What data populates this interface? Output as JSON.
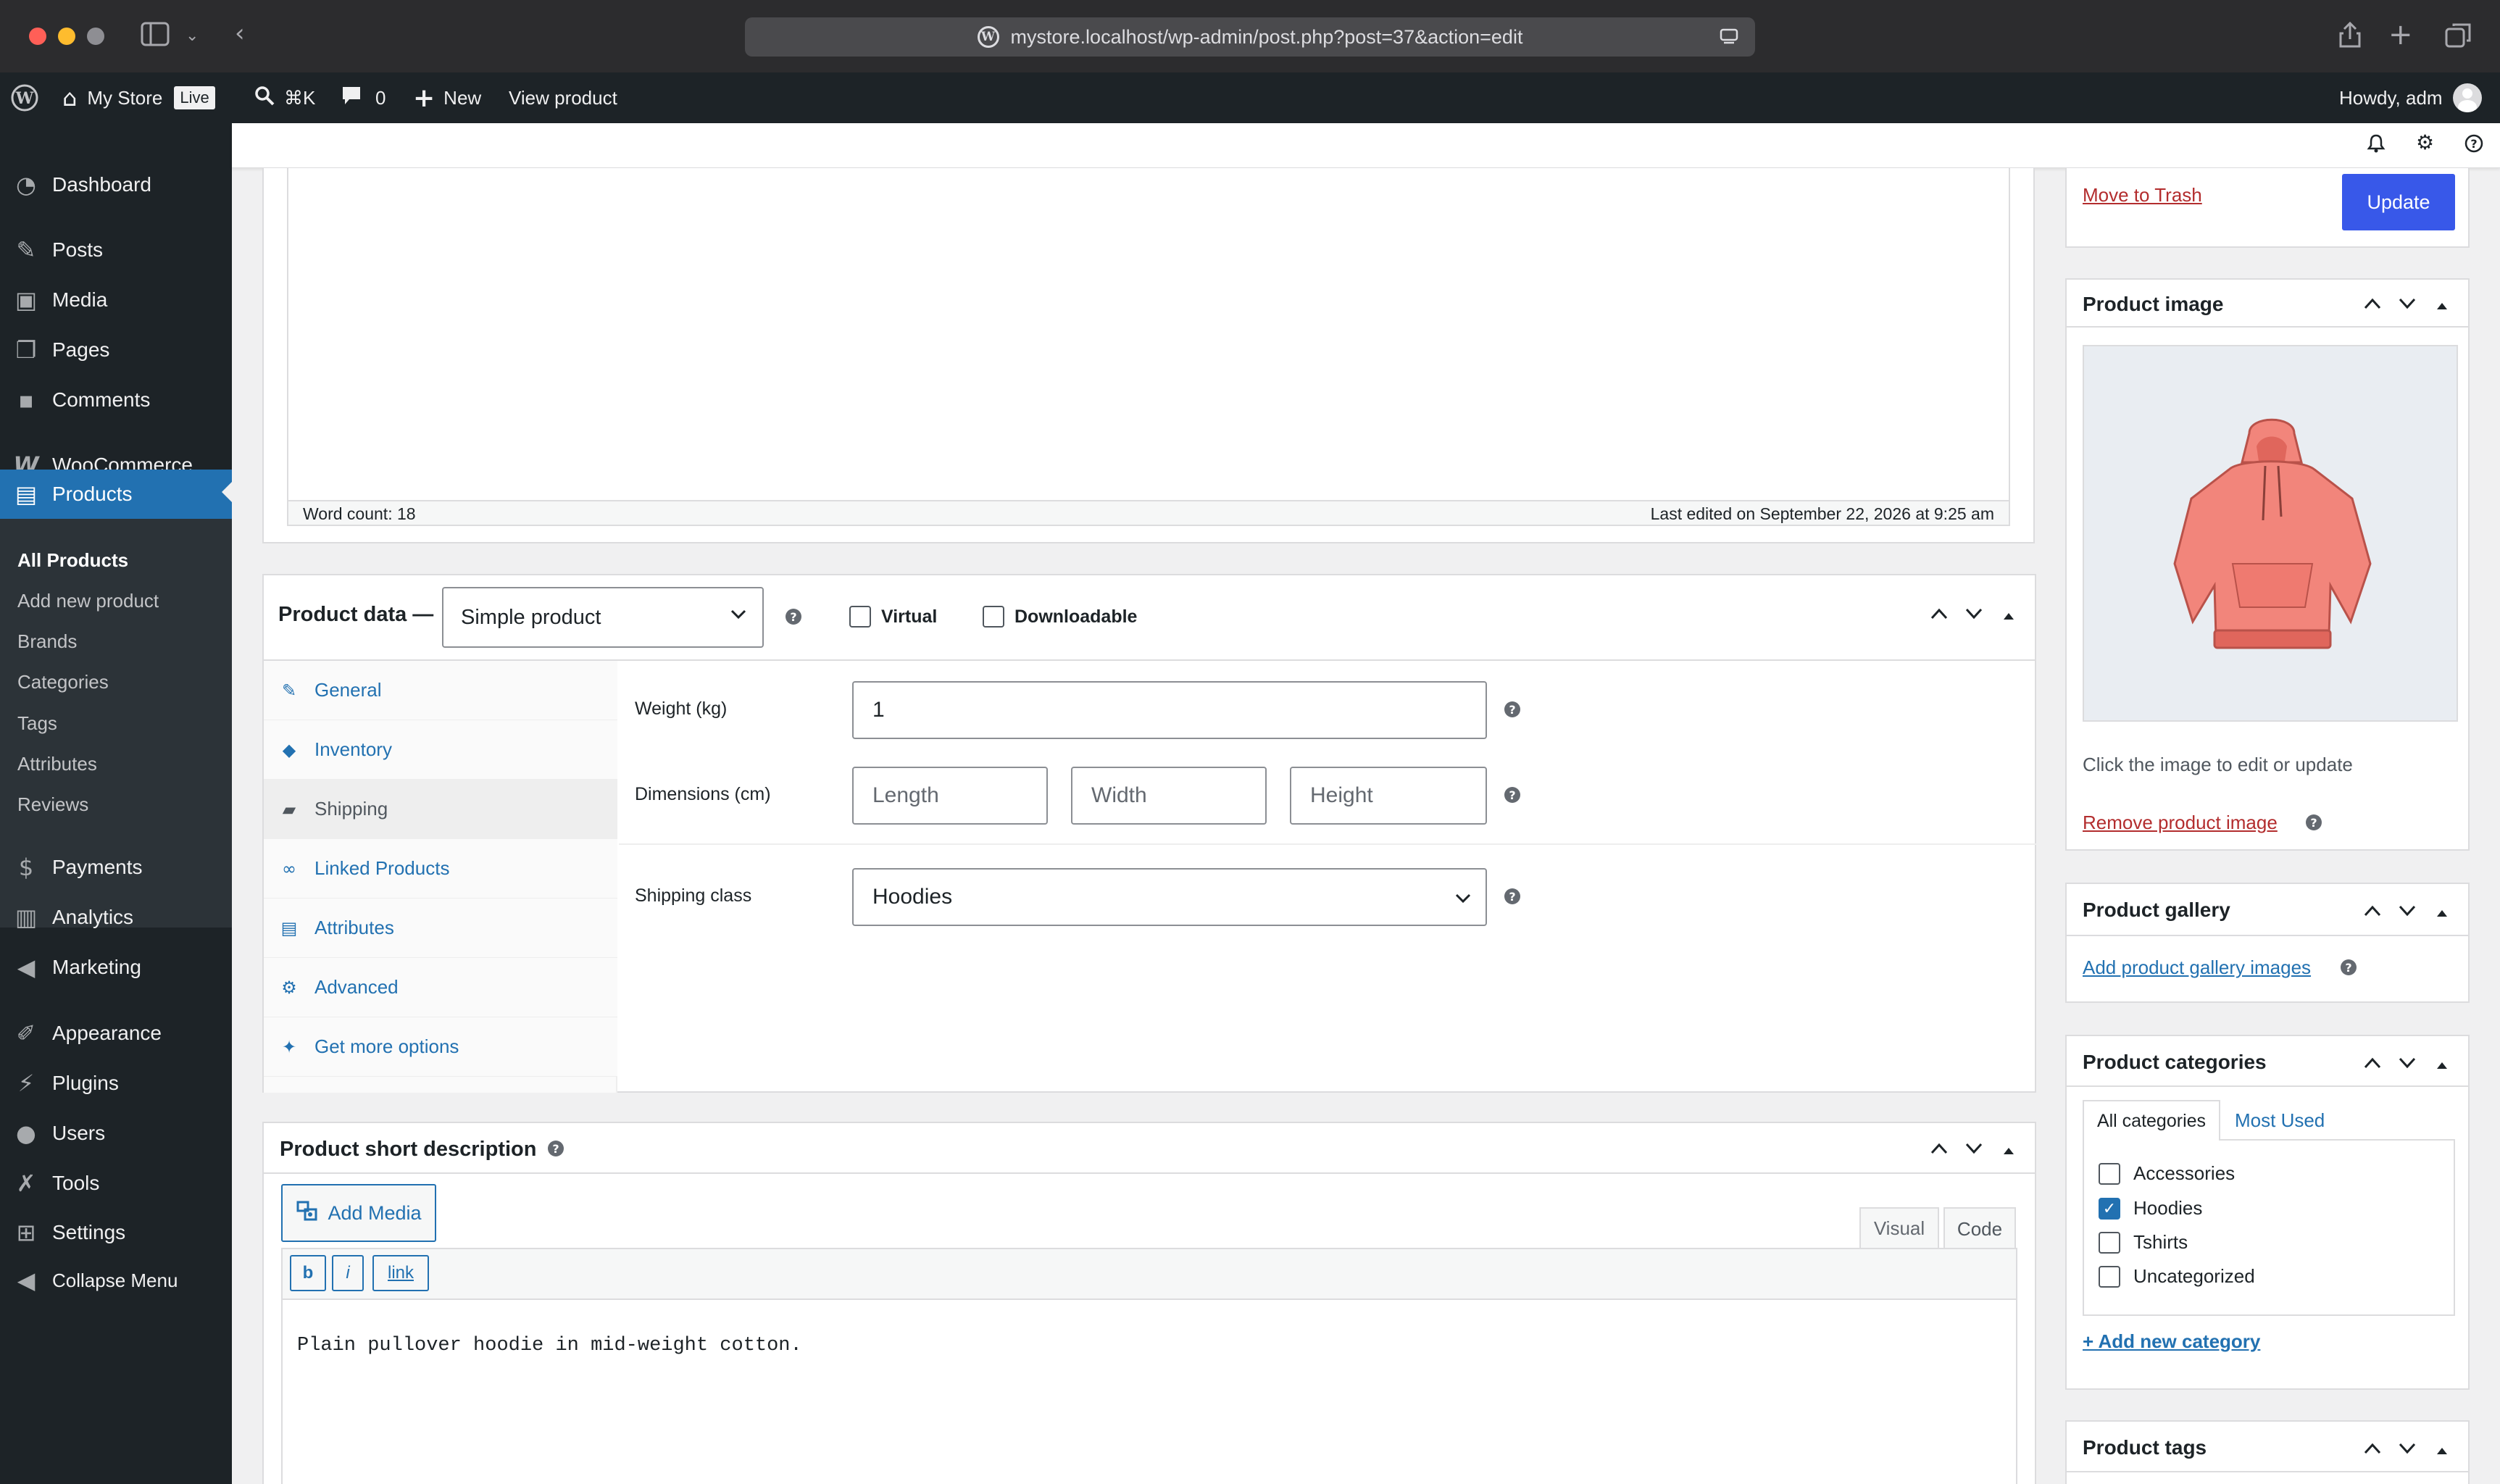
{
  "browser": {
    "url": "mystore.localhost/wp-admin/post.php?post=37&action=edit"
  },
  "adminbar": {
    "site_name": "My Store",
    "live_badge": "Live",
    "shortcut": "⌘K",
    "comments_count": "0",
    "new_label": "New",
    "view_product": "View product",
    "howdy": "Howdy, adm"
  },
  "sidebar": {
    "items": [
      {
        "label": "Dashboard"
      },
      {
        "label": "Posts"
      },
      {
        "label": "Media"
      },
      {
        "label": "Pages"
      },
      {
        "label": "Comments"
      },
      {
        "label": "WooCommerce"
      },
      {
        "label": "Products"
      },
      {
        "label": "Payments"
      },
      {
        "label": "Analytics"
      },
      {
        "label": "Marketing"
      },
      {
        "label": "Appearance"
      },
      {
        "label": "Plugins"
      },
      {
        "label": "Users"
      },
      {
        "label": "Tools"
      },
      {
        "label": "Settings"
      },
      {
        "label": "Collapse Menu"
      }
    ],
    "submenu": [
      {
        "label": "All Products"
      },
      {
        "label": "Add new product"
      },
      {
        "label": "Brands"
      },
      {
        "label": "Categories"
      },
      {
        "label": "Tags"
      },
      {
        "label": "Attributes"
      },
      {
        "label": "Reviews"
      }
    ]
  },
  "editor": {
    "word_count": "Word count: 18",
    "last_edited": "Last edited on September 22, 2026 at 9:25 am"
  },
  "product_data": {
    "title": "Product data —",
    "type_selected": "Simple product",
    "virtual_label": "Virtual",
    "downloadable_label": "Downloadable",
    "tabs": [
      {
        "label": "General"
      },
      {
        "label": "Inventory"
      },
      {
        "label": "Shipping"
      },
      {
        "label": "Linked Products"
      },
      {
        "label": "Attributes"
      },
      {
        "label": "Advanced"
      },
      {
        "label": "Get more options"
      }
    ],
    "weight_label": "Weight (kg)",
    "weight_value": "1",
    "dimensions_label": "Dimensions (cm)",
    "length_placeholder": "Length",
    "width_placeholder": "Width",
    "height_placeholder": "Height",
    "shipping_class_label": "Shipping class",
    "shipping_class_value": "Hoodies"
  },
  "short_description": {
    "title": "Product short description",
    "add_media": "Add Media",
    "visual_tab": "Visual",
    "code_tab": "Code",
    "qt_bold": "b",
    "qt_italic": "i",
    "qt_link": "link",
    "content": "Plain pullover hoodie in mid-weight cotton."
  },
  "publish": {
    "trash_link": "Move to Trash",
    "update_button": "Update"
  },
  "product_image": {
    "title": "Product image",
    "hint": "Click the image to edit or update",
    "remove_link": "Remove product image"
  },
  "product_gallery": {
    "title": "Product gallery",
    "add_link": "Add product gallery images"
  },
  "product_categories": {
    "title": "Product categories",
    "tab_all": "All categories",
    "tab_most_used": "Most Used",
    "items": [
      {
        "label": "Accessories",
        "checked": false
      },
      {
        "label": "Hoodies",
        "checked": true
      },
      {
        "label": "Tshirts",
        "checked": false
      },
      {
        "label": "Uncategorized",
        "checked": false
      }
    ],
    "add_new": "+ Add new category"
  },
  "product_tags": {
    "title": "Product tags"
  },
  "colors": {
    "admin_dark": "#1d2327",
    "accent_blue": "#2271b1",
    "button_blue": "#3858e9",
    "danger_red": "#b32d2e",
    "hoodie": "#f2857b"
  }
}
